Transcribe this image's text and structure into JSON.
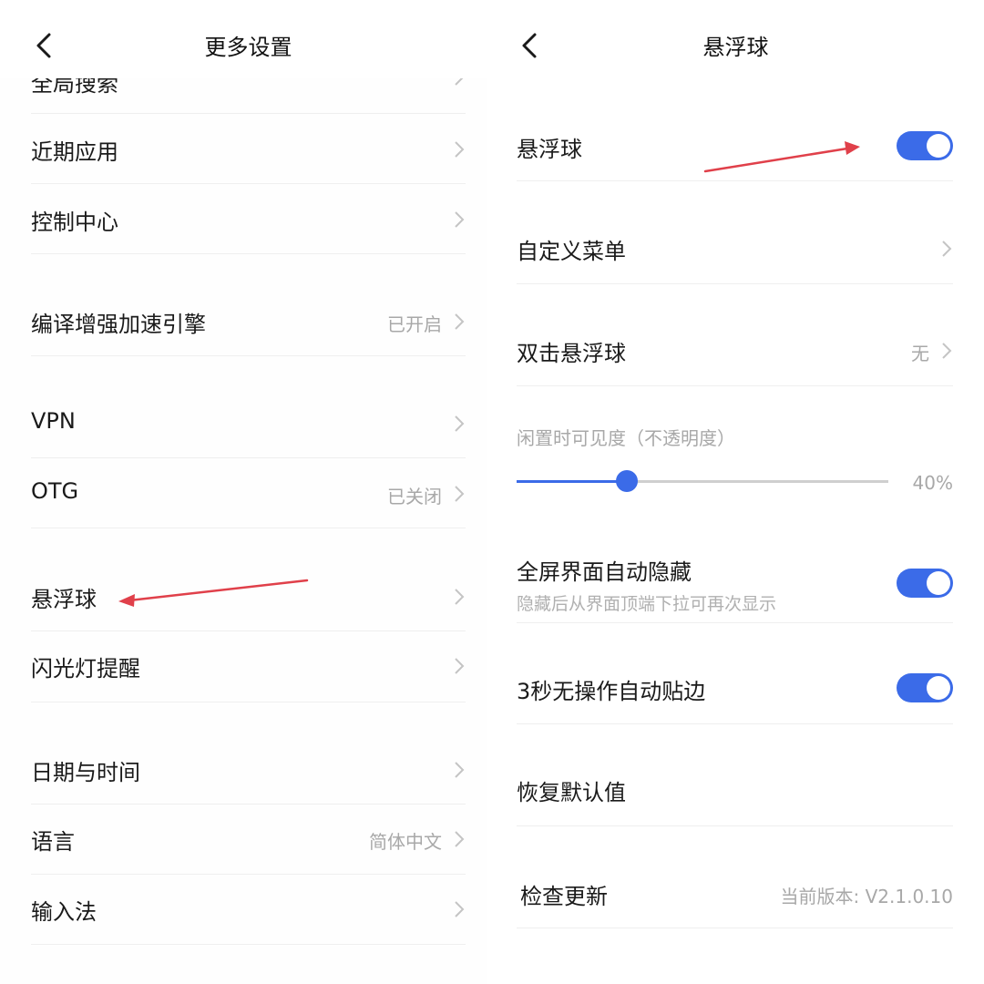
{
  "left": {
    "title": "更多设置",
    "cut_item": "全局搜索",
    "items": [
      {
        "label": "近期应用",
        "value": ""
      },
      {
        "label": "控制中心",
        "value": ""
      },
      {
        "label": "编译增强加速引擎",
        "value": "已开启"
      },
      {
        "label": "VPN",
        "value": ""
      },
      {
        "label": "OTG",
        "value": "已关闭"
      },
      {
        "label": "悬浮球",
        "value": ""
      },
      {
        "label": "闪光灯提醒",
        "value": ""
      },
      {
        "label": "日期与时间",
        "value": ""
      },
      {
        "label": "语言",
        "value": "简体中文"
      },
      {
        "label": "输入法",
        "value": ""
      }
    ]
  },
  "right": {
    "title": "悬浮球",
    "floating_ball": {
      "label": "悬浮球",
      "enabled": true
    },
    "custom_menu": {
      "label": "自定义菜单"
    },
    "double_tap": {
      "label": "双击悬浮球",
      "value": "无"
    },
    "idle_visibility": {
      "label": "闲置时可见度（不透明度）",
      "value_text": "40%",
      "value": 0.4
    },
    "fullscreen_hide": {
      "label": "全屏界面自动隐藏",
      "sub": "隐藏后从界面顶端下拉可再次显示",
      "enabled": true
    },
    "auto_edge": {
      "label": "3秒无操作自动贴边",
      "enabled": true
    },
    "restore_default": {
      "label": "恢复默认值"
    },
    "check_update": {
      "label": "检查更新",
      "value": "当前版本: V2.1.0.10"
    }
  },
  "colors": {
    "accent": "#3b6be8",
    "annotation_arrow": "#e0404a",
    "secondary_text": "#a8a8a8"
  }
}
